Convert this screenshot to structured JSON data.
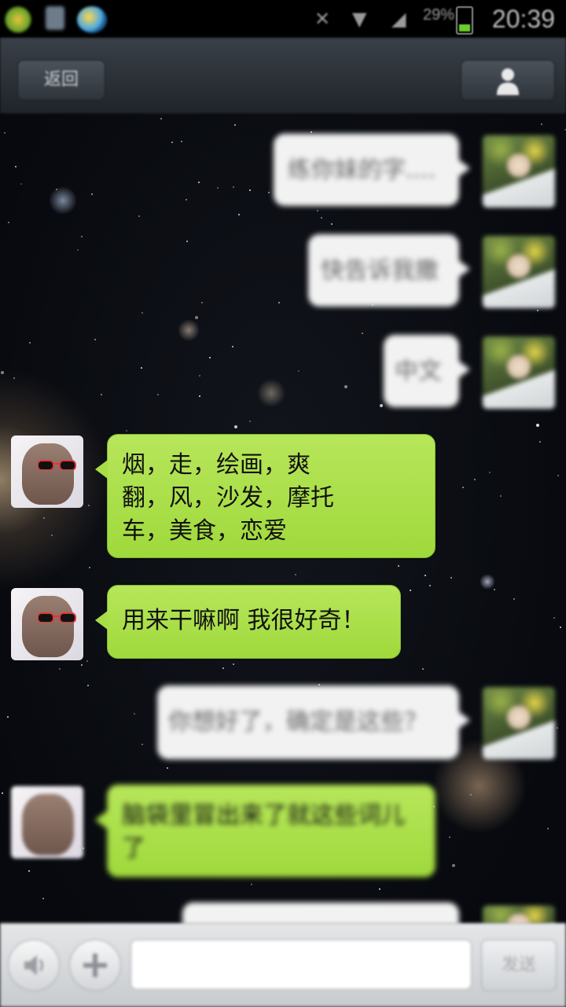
{
  "status_bar": {
    "time": "20:39",
    "battery": "29%",
    "icons": [
      "notification-icon",
      "usb-icon",
      "app-icon",
      "mute-icon",
      "wifi-icon",
      "signal-icon",
      "battery-icon"
    ]
  },
  "header": {
    "back_label": "返回",
    "contact_icon": "person-icon"
  },
  "messages": [
    {
      "side": "right",
      "text": "练你妹的字....",
      "blurred": true
    },
    {
      "side": "right",
      "text": "快告诉我撒",
      "blurred": true
    },
    {
      "side": "right",
      "text": "中文",
      "blurred": true
    },
    {
      "side": "left",
      "lines": [
        "烟，走，绘画，爽",
        "翻，风，沙发，摩托",
        "车，美食，恋爱"
      ],
      "blurred": false
    },
    {
      "side": "left",
      "text": "用来干嘛啊 我很好奇！",
      "blurred": false
    },
    {
      "side": "right",
      "text": "你想好了，确定是这些？",
      "blurred": true
    },
    {
      "side": "left",
      "lines": [
        "脑袋里冒出来了就这些词儿",
        "了"
      ],
      "blurred": true
    }
  ],
  "input_bar": {
    "voice_icon": "speaker-icon",
    "plus_icon": "plus-icon",
    "input_value": "",
    "send_label": "发送"
  },
  "colors": {
    "green_bubble": "#a7de45",
    "white_bubble": "#f2f2f2",
    "titlebar": "#2b3036"
  }
}
